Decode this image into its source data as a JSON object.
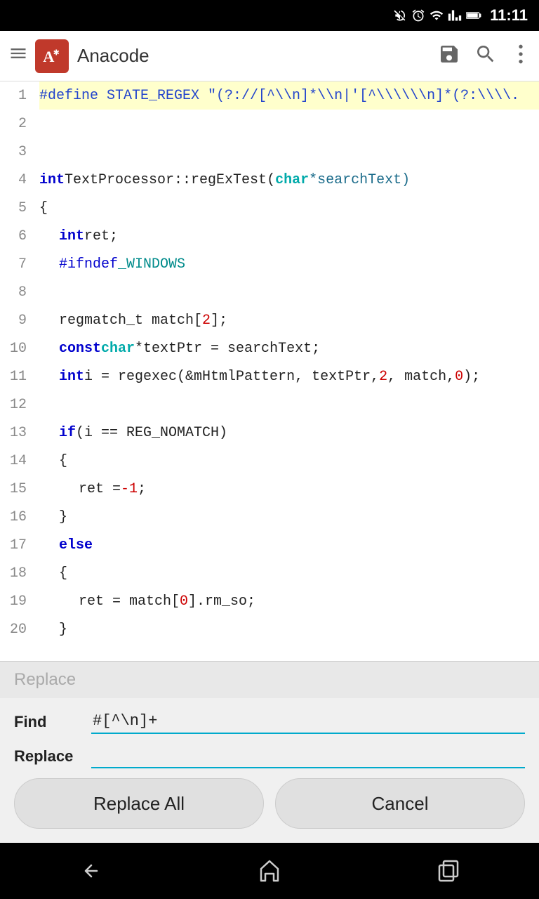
{
  "statusBar": {
    "time": "11:11",
    "icons": [
      "mute-icon",
      "alarm-icon",
      "wifi-icon",
      "signal-icon",
      "battery-icon"
    ]
  },
  "appBar": {
    "title": "Anacode",
    "menuIcon": "menu-icon",
    "logoAlt": "Anacode logo",
    "saveIcon": "save-icon",
    "searchIcon": "search-icon",
    "moreIcon": "more-icon"
  },
  "codeLines": [
    {
      "num": "1",
      "highlight": true,
      "raw": "#define STATE_REGEX  \"(?://[^\\\\n]*\\\\n|'[^\\\\\\\\\\\\n]*(?:\\\\\\\\."
    },
    {
      "num": "2",
      "highlight": false,
      "raw": ""
    },
    {
      "num": "3",
      "highlight": false,
      "raw": ""
    },
    {
      "num": "4",
      "highlight": false,
      "tokens": [
        {
          "t": "int",
          "c": "kw-blue"
        },
        {
          "t": " TextProcessor::regExTest(",
          "c": "normal"
        },
        {
          "t": "char",
          "c": "kw-cyan"
        },
        {
          "t": " *searchText)",
          "c": "param"
        }
      ]
    },
    {
      "num": "5",
      "highlight": false,
      "raw": "{"
    },
    {
      "num": "6",
      "highlight": false,
      "indent": 1,
      "tokens": [
        {
          "t": "int",
          "c": "kw-blue"
        },
        {
          "t": " ret;",
          "c": "normal"
        }
      ]
    },
    {
      "num": "7",
      "highlight": false,
      "indent": 1,
      "tokens": [
        {
          "t": "#ifndef",
          "c": "preprocessor"
        },
        {
          "t": " _WINDOWS",
          "c": "kw-teal"
        }
      ]
    },
    {
      "num": "8",
      "highlight": false,
      "raw": ""
    },
    {
      "num": "9",
      "highlight": false,
      "indent": 1,
      "tokens": [
        {
          "t": "regmatch_t match[",
          "c": "normal"
        },
        {
          "t": "2",
          "c": "number"
        },
        {
          "t": "];",
          "c": "normal"
        }
      ]
    },
    {
      "num": "10",
      "highlight": false,
      "indent": 1,
      "tokens": [
        {
          "t": "const",
          "c": "kw-blue"
        },
        {
          "t": " ",
          "c": "normal"
        },
        {
          "t": "char",
          "c": "kw-cyan"
        },
        {
          "t": " *textPtr = searchText;",
          "c": "normal"
        }
      ]
    },
    {
      "num": "11",
      "highlight": false,
      "indent": 1,
      "tokens": [
        {
          "t": "int",
          "c": "kw-blue"
        },
        {
          "t": " i = regexec(&mHtmlPattern, textPtr, ",
          "c": "normal"
        },
        {
          "t": "2",
          "c": "number"
        },
        {
          "t": ", match, ",
          "c": "normal"
        },
        {
          "t": "0",
          "c": "number"
        },
        {
          "t": ");",
          "c": "normal"
        }
      ]
    },
    {
      "num": "12",
      "highlight": false,
      "raw": ""
    },
    {
      "num": "13",
      "highlight": false,
      "indent": 1,
      "tokens": [
        {
          "t": "if",
          "c": "kw-blue"
        },
        {
          "t": " (i == REG_NOMATCH)",
          "c": "normal"
        }
      ]
    },
    {
      "num": "14",
      "highlight": false,
      "indent": 1,
      "raw": "{"
    },
    {
      "num": "15",
      "highlight": false,
      "indent": 2,
      "tokens": [
        {
          "t": "ret = ",
          "c": "normal"
        },
        {
          "t": "-1",
          "c": "number"
        },
        {
          "t": ";",
          "c": "normal"
        }
      ]
    },
    {
      "num": "16",
      "highlight": false,
      "indent": 1,
      "raw": "}"
    },
    {
      "num": "17",
      "highlight": false,
      "indent": 1,
      "tokens": [
        {
          "t": "else",
          "c": "kw-blue"
        }
      ]
    },
    {
      "num": "18",
      "highlight": false,
      "indent": 1,
      "raw": "{"
    },
    {
      "num": "19",
      "highlight": false,
      "indent": 2,
      "tokens": [
        {
          "t": "ret = match[",
          "c": "normal"
        },
        {
          "t": "0",
          "c": "number"
        },
        {
          "t": "].rm_so;",
          "c": "normal"
        }
      ]
    },
    {
      "num": "20",
      "highlight": false,
      "indent": 1,
      "raw": "}"
    }
  ],
  "replaceBar": {
    "placeholder": "Replace"
  },
  "findReplace": {
    "findLabel": "Find",
    "findValue": "#[^\\n]+",
    "replaceLabel": "Replace",
    "replaceValue": "",
    "replaceAllLabel": "Replace All",
    "cancelLabel": "Cancel"
  },
  "bottomNav": {
    "backIcon": "back-icon",
    "homeIcon": "home-icon",
    "recentsIcon": "recents-icon"
  }
}
